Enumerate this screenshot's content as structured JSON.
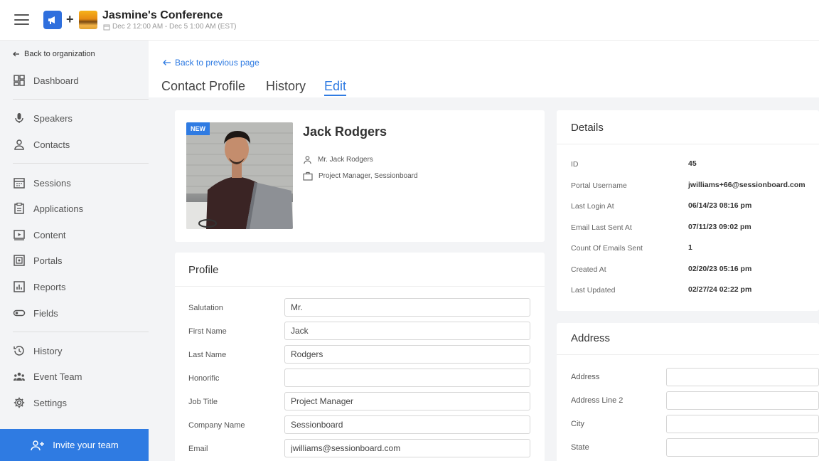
{
  "header": {
    "plus": "+",
    "title": "Jasmine's Conference",
    "date_range": "Dec 2 12:00 AM - Dec 5 1:00 AM (EST)"
  },
  "sidebar": {
    "back_label": "Back to organization",
    "items": [
      {
        "label": "Dashboard",
        "icon": "dashboard-icon"
      },
      {
        "label": "Speakers",
        "icon": "microphone-icon"
      },
      {
        "label": "Contacts",
        "icon": "person-icon"
      },
      {
        "label": "Sessions",
        "icon": "calendar-icon"
      },
      {
        "label": "Applications",
        "icon": "clipboard-icon"
      },
      {
        "label": "Content",
        "icon": "video-icon"
      },
      {
        "label": "Portals",
        "icon": "portal-icon"
      },
      {
        "label": "Reports",
        "icon": "chart-icon"
      },
      {
        "label": "Fields",
        "icon": "toggle-icon"
      },
      {
        "label": "History",
        "icon": "history-icon"
      },
      {
        "label": "Event Team",
        "icon": "team-icon"
      },
      {
        "label": "Settings",
        "icon": "gear-icon"
      }
    ],
    "invite_label": "Invite your team"
  },
  "page": {
    "back_label": "Back to previous page",
    "tabs": [
      {
        "label": "Contact Profile",
        "active": false
      },
      {
        "label": "History",
        "active": false
      },
      {
        "label": "Edit",
        "active": true
      }
    ]
  },
  "contact": {
    "badge": "NEW",
    "name": "Jack Rodgers",
    "full_name_line": "Mr. Jack Rodgers",
    "job_line": "Project Manager, Sessionboard"
  },
  "profile": {
    "title": "Profile",
    "fields": [
      {
        "label": "Salutation",
        "value": ""
      },
      {
        "label": "First Name",
        "value": "Jack"
      },
      {
        "label": "Last Name",
        "value": "Rodgers"
      },
      {
        "label": "Honorific",
        "value": ""
      },
      {
        "label": "Job Title",
        "value": "Project Manager"
      },
      {
        "label": "Company Name",
        "value": "Sessionboard"
      },
      {
        "label": "Email",
        "value": "jwilliams@sessionboard.com"
      }
    ],
    "salutation_value": "Mr."
  },
  "details": {
    "title": "Details",
    "rows": [
      {
        "label": "ID",
        "value": "45"
      },
      {
        "label": "Portal Username",
        "value": "jwilliams+66@sessionboard.com"
      },
      {
        "label": "Last Login At",
        "value": "06/14/23 08:16 pm"
      },
      {
        "label": "Email Last Sent At",
        "value": "07/11/23 09:02 pm"
      },
      {
        "label": "Count Of Emails Sent",
        "value": "1"
      },
      {
        "label": "Created At",
        "value": "02/20/23 05:16 pm"
      },
      {
        "label": "Last Updated",
        "value": "02/27/24 02:22 pm"
      }
    ]
  },
  "address": {
    "title": "Address",
    "fields": [
      {
        "label": "Address",
        "value": ""
      },
      {
        "label": "Address Line 2",
        "value": ""
      },
      {
        "label": "City",
        "value": ""
      },
      {
        "label": "State",
        "value": ""
      }
    ]
  },
  "colors": {
    "accent": "#2f7be2",
    "badge": "#2f7be2"
  }
}
